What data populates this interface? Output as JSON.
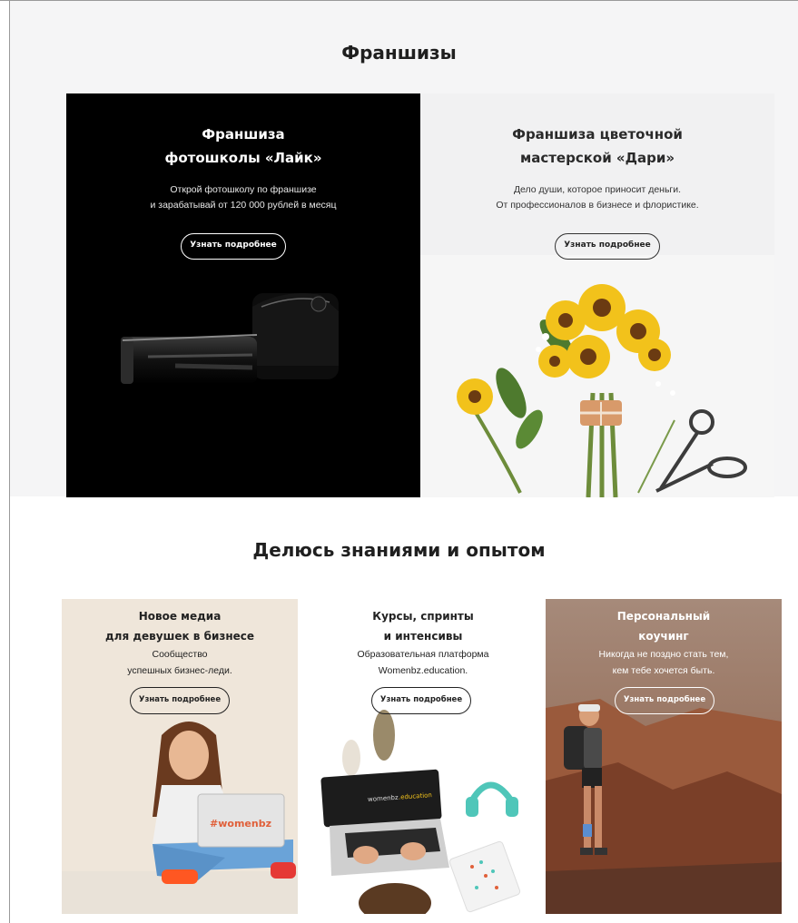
{
  "sections": [
    {
      "title": "Франшизы"
    },
    {
      "title": "Делюсь знаниями и опытом"
    }
  ],
  "franchise_cards": [
    {
      "title_1": "Франшиза",
      "title_2": "фотошколы «Лайк»",
      "desc_1": "Открой фотошколу по франшизе",
      "desc_2": "и зарабатывай от 120 000 рублей в месяц",
      "button": "Узнать подробнее"
    },
    {
      "title_1": "Франшиза цветочной",
      "title_2": "мастерской «Дари»",
      "desc_1": "Дело души, которое приносит деньги.",
      "desc_2": "От профессионалов в бизнесе и флористике.",
      "button": "Узнать подробнее"
    }
  ],
  "knowledge_cards": [
    {
      "title_1": "Новое медиа",
      "title_2": "для девушек в бизнесе",
      "desc_1": "Сообщество",
      "desc_2": "успешных бизнес-леди.",
      "button": "Узнать подробнее",
      "laptop_text": "#womenbz"
    },
    {
      "title_1": "Курсы, спринты",
      "title_2": "и интенсивы",
      "desc_1": "Образовательная платформа",
      "desc_2": "Womenbz.education.",
      "button": "Узнать подробнее",
      "screen_text_1": "womenbz",
      "screen_text_2": ".education"
    },
    {
      "title_1": "Персональный",
      "title_2": "коучинг",
      "desc_1": "Никогда не поздно стать тем,",
      "desc_2": "кем тебе хочется быть.",
      "button": "Узнать подробнее"
    }
  ],
  "colors": {
    "accent_orange": "#ff5722",
    "background": "#f5f5f6",
    "text": "#1f1f1f"
  }
}
